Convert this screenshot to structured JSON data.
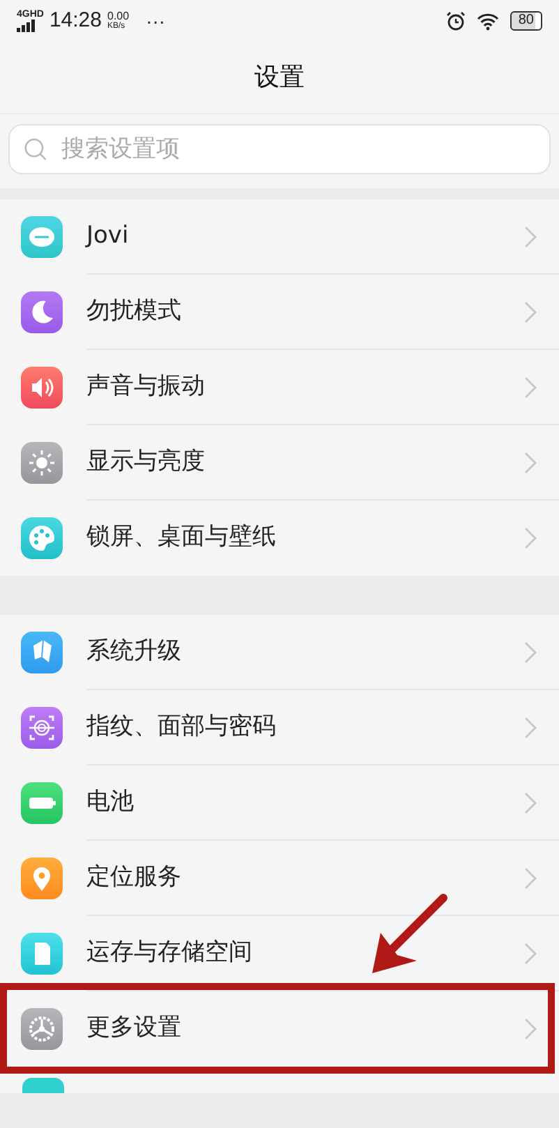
{
  "status_bar": {
    "network": "4G",
    "network_sub": "HD",
    "time": "14:28",
    "speed": "0.00",
    "speed_unit": "KB/s",
    "more": "···",
    "battery": "80"
  },
  "title": "设置",
  "search": {
    "placeholder": "搜索设置项"
  },
  "groups": [
    {
      "items": [
        {
          "label": "Jovi",
          "highlighted": false
        },
        {
          "label": "勿扰模式",
          "highlighted": false
        },
        {
          "label": "声音与振动",
          "highlighted": false
        },
        {
          "label": "显示与亮度",
          "highlighted": false
        },
        {
          "label": "锁屏、桌面与壁纸",
          "highlighted": false
        }
      ]
    },
    {
      "items": [
        {
          "label": "系统升级",
          "highlighted": false
        },
        {
          "label": "指纹、面部与密码",
          "highlighted": false
        },
        {
          "label": "电池",
          "highlighted": false
        },
        {
          "label": "定位服务",
          "highlighted": false
        },
        {
          "label": "运存与存储空间",
          "highlighted": false
        },
        {
          "label": "更多设置",
          "highlighted": true
        }
      ]
    }
  ]
}
